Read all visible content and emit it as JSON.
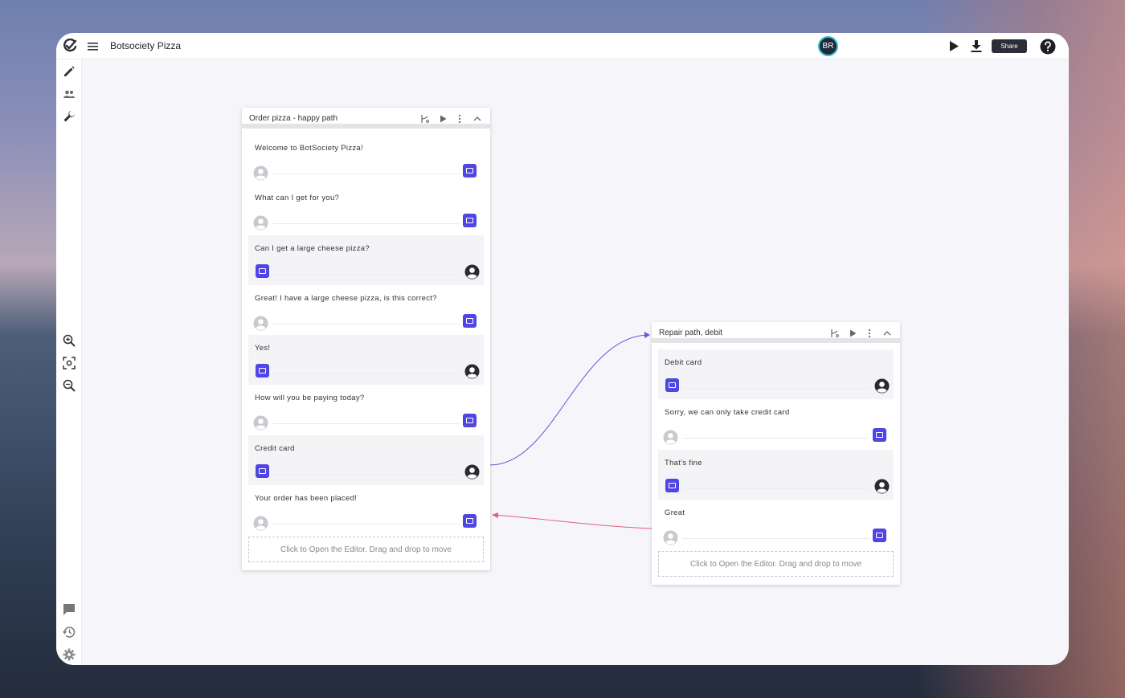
{
  "app": {
    "title": "Botsociety Pizza",
    "avatar_initials": "BR"
  },
  "toolbar": {
    "share_label": "Share"
  },
  "icons": {
    "logo": "botsociety-logo-icon",
    "menu": "hamburger-menu-icon",
    "play": "play-icon",
    "download": "download-icon",
    "help": "help-icon",
    "sidebar_top": [
      "pencil-icon",
      "users-icon",
      "wrench-icon"
    ],
    "sidebar_zoom": [
      "zoom-in-icon",
      "fit-view-icon",
      "zoom-out-icon"
    ],
    "sidebar_bottom": [
      "comment-icon",
      "history-icon",
      "settings-icon"
    ]
  },
  "colors": {
    "accent": "#4f46e5",
    "share_bg": "#2b2d38",
    "link_out": "#5b5bd6",
    "link_back": "#e0607a",
    "avatar_ring": "#2fc0d0"
  },
  "boards": [
    {
      "title": "Order pizza - happy path",
      "editor_hint": "Click to Open the Editor. Drag and drop to move",
      "messages": [
        {
          "text": "Welcome to BotSociety Pizza!",
          "speaker": "bot"
        },
        {
          "text": "What can I get for you?",
          "speaker": "bot"
        },
        {
          "text": "Can I get a large cheese pizza?",
          "speaker": "user"
        },
        {
          "text": "Great! I have a large cheese pizza, is this correct?",
          "speaker": "bot"
        },
        {
          "text": "Yes!",
          "speaker": "user"
        },
        {
          "text": "How will you be paying today?",
          "speaker": "bot"
        },
        {
          "text": "Credit card",
          "speaker": "user"
        },
        {
          "text": "Your order has been placed!",
          "speaker": "bot"
        }
      ]
    },
    {
      "title": "Repair path, debit",
      "editor_hint": "Click to Open the Editor. Drag and drop to move",
      "messages": [
        {
          "text": "Debit card",
          "speaker": "user"
        },
        {
          "text": "Sorry, we can only take credit card",
          "speaker": "bot"
        },
        {
          "text": "That's fine",
          "speaker": "user"
        },
        {
          "text": "Great",
          "speaker": "bot"
        }
      ]
    }
  ]
}
